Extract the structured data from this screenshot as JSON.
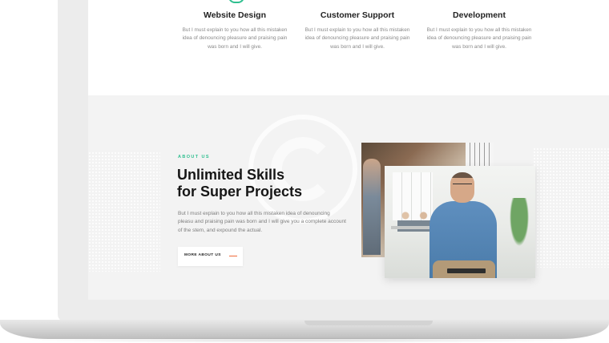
{
  "services": [
    {
      "title": "Website Design",
      "text": "But I must explain to you how all this mistaken idea of denouncing pleasure and praising pain was born and I will give."
    },
    {
      "title": "Customer Support",
      "text": "But I must explain to you how all this mistaken idea of denouncing pleasure and praising pain was born and I will give."
    },
    {
      "title": "Development",
      "text": "But I must explain to you how all this mistaken idea of denouncing pleasure and praising pain was born and I will give."
    }
  ],
  "about": {
    "eyebrow": "ABOUT US",
    "headline_line1": "Unlimited Skills",
    "headline_line2": "for Super Projects",
    "body": "But I must explain to you how all this mistaken idea of denouncing pleasu and praising pain was born and I will give you a complete account of the stem, and expound the actual.",
    "button_label": "MORE ABOUT US"
  },
  "colors": {
    "accent": "#2fbf8f",
    "button_dash": "#ef6b3a",
    "section_bg": "#f3f3f3"
  }
}
